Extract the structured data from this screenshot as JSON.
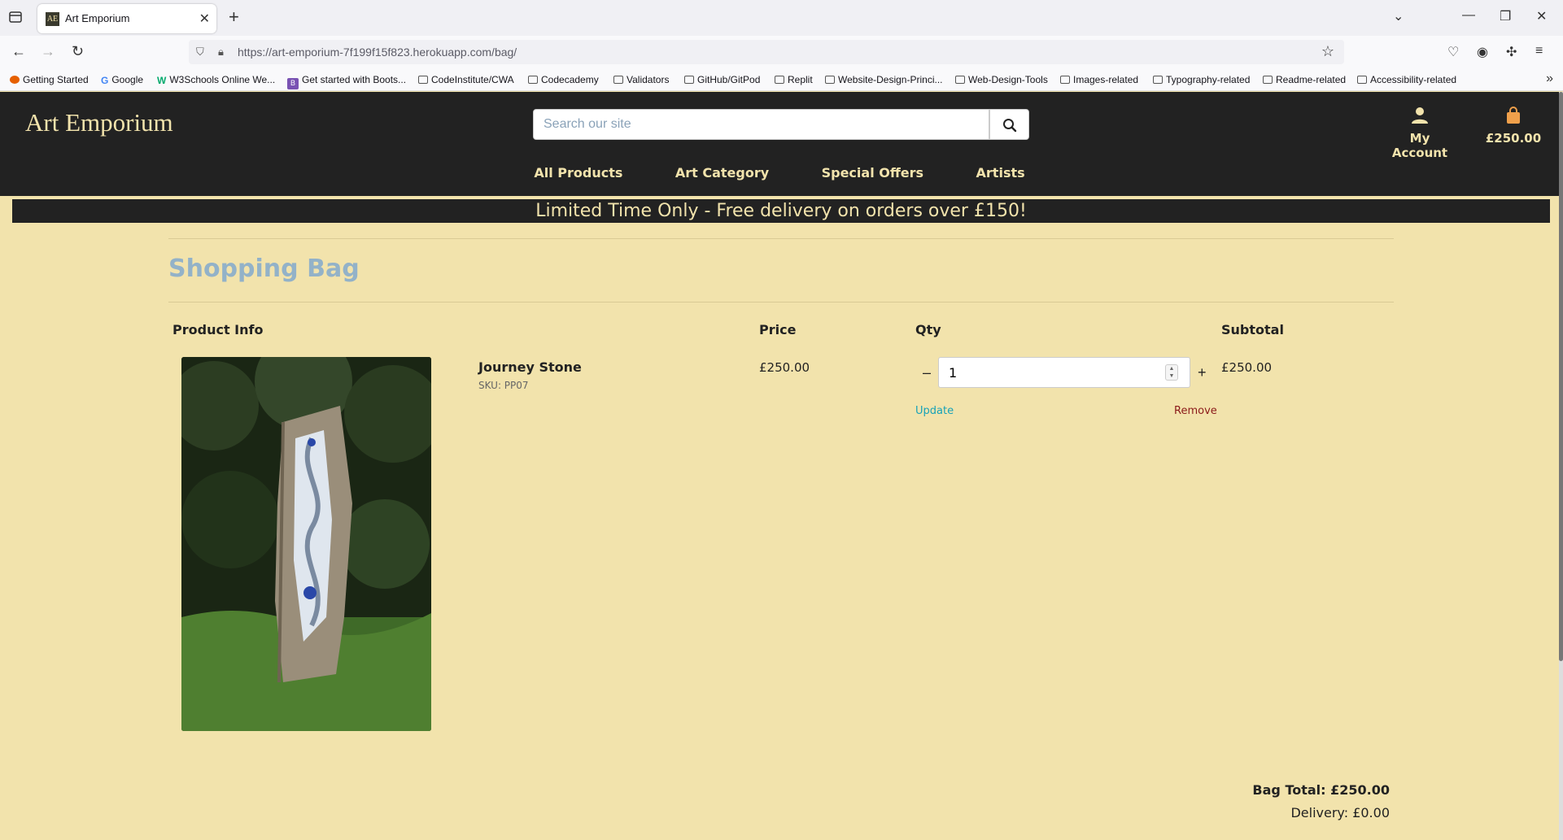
{
  "browser": {
    "tab_title": "Art Emporium",
    "tab_favicon_text": "AE",
    "url": "https://art-emporium-7f199f15f823.herokuapp.com/bag/",
    "bookmarks": [
      "Getting Started",
      "Google",
      "W3Schools Online We...",
      "Get started with Boots...",
      "CodeInstitute/CWA",
      "Codecademy",
      "Validators",
      "GitHub/GitPod",
      "Replit",
      "Website-Design-Princi...",
      "Web-Design-Tools",
      "Images-related",
      "Typography-related",
      "Readme-related",
      "Accessibility-related"
    ]
  },
  "header": {
    "logo": "Art Emporium",
    "search_placeholder": "Search our site",
    "account_label": "My Account",
    "cart_total": "£250.00",
    "nav": [
      "All Products",
      "Art Category",
      "Special Offers",
      "Artists"
    ],
    "banner": "Limited Time Only - Free delivery on orders over £150!"
  },
  "bag": {
    "title": "Shopping Bag",
    "columns": [
      "Product Info",
      "Price",
      "Qty",
      "Subtotal"
    ],
    "items": [
      {
        "name": "Journey Stone",
        "sku": "SKU: PP07",
        "price": "£250.00",
        "qty": "1",
        "subtotal": "£250.00",
        "update_label": "Update",
        "remove_label": "Remove"
      }
    ],
    "bag_total": "Bag Total: £250.00",
    "delivery": "Delivery: £0.00"
  },
  "colors": {
    "page_bg": "#f2e3ac",
    "header_bg": "#222222",
    "accent_text": "#f2e3ac",
    "title_blue": "#93b2c8",
    "update_link": "#17a2b8",
    "remove_link": "#8b1a1a"
  }
}
